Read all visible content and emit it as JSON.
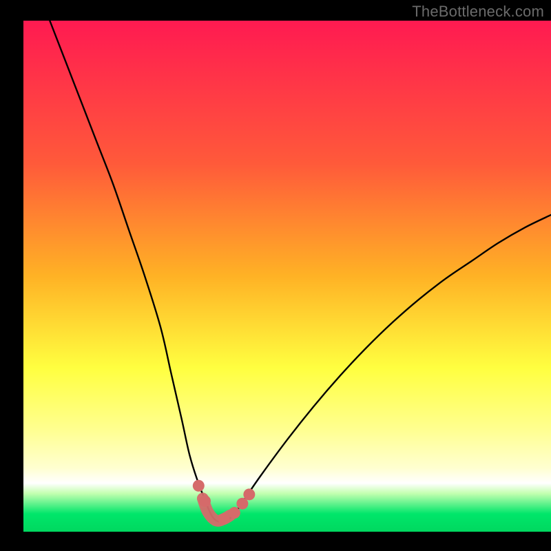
{
  "watermark": "TheBottleneck.com",
  "colors": {
    "frame_bg": "#000000",
    "grad_top": "#ff1a51",
    "grad_mid1": "#ff6a2f",
    "grad_mid2": "#ffd31a",
    "grad_mid3": "#ffff40",
    "grad_light": "#ffffd0",
    "grad_green_light": "#c4ffb0",
    "grad_green": "#00e66a",
    "curve": "#000000",
    "marker_fill": "#d56a6a",
    "marker_stroke": "#b94f4f",
    "segment_stroke": "#d56a6a"
  },
  "chart_data": {
    "type": "line",
    "title": "",
    "xlabel": "",
    "ylabel": "",
    "xlim": [
      0,
      100
    ],
    "ylim": [
      0,
      100
    ],
    "series": [
      {
        "name": "bottleneck-curve",
        "x": [
          5,
          8,
          11,
          14,
          17,
          20,
          23,
          26,
          28,
          30,
          31.5,
          33,
          34.5,
          35.5,
          36.5,
          37.5,
          38.5,
          40,
          42,
          45,
          50,
          55,
          60,
          65,
          70,
          75,
          80,
          85,
          90,
          95,
          100
        ],
        "y": [
          100,
          92,
          84,
          76,
          68,
          59,
          50,
          40,
          31,
          22,
          15,
          10,
          6,
          3.5,
          2.2,
          2,
          2.2,
          3.5,
          6.5,
          11,
          18,
          24.5,
          30.5,
          36,
          41,
          45.5,
          49.5,
          53,
          56.5,
          59.5,
          62
        ]
      }
    ],
    "markers": {
      "name": "highlight-points",
      "x": [
        33.2,
        34.4,
        38.0,
        40.0,
        41.5,
        42.8
      ],
      "y": [
        9.0,
        6.0,
        2.5,
        3.7,
        5.5,
        7.3
      ]
    },
    "thick_segment": {
      "name": "valley-segment",
      "x": [
        34.0,
        35.0,
        36.5,
        38.0,
        39.2
      ],
      "y": [
        6.5,
        3.8,
        2.2,
        2.5,
        3.2
      ]
    }
  }
}
